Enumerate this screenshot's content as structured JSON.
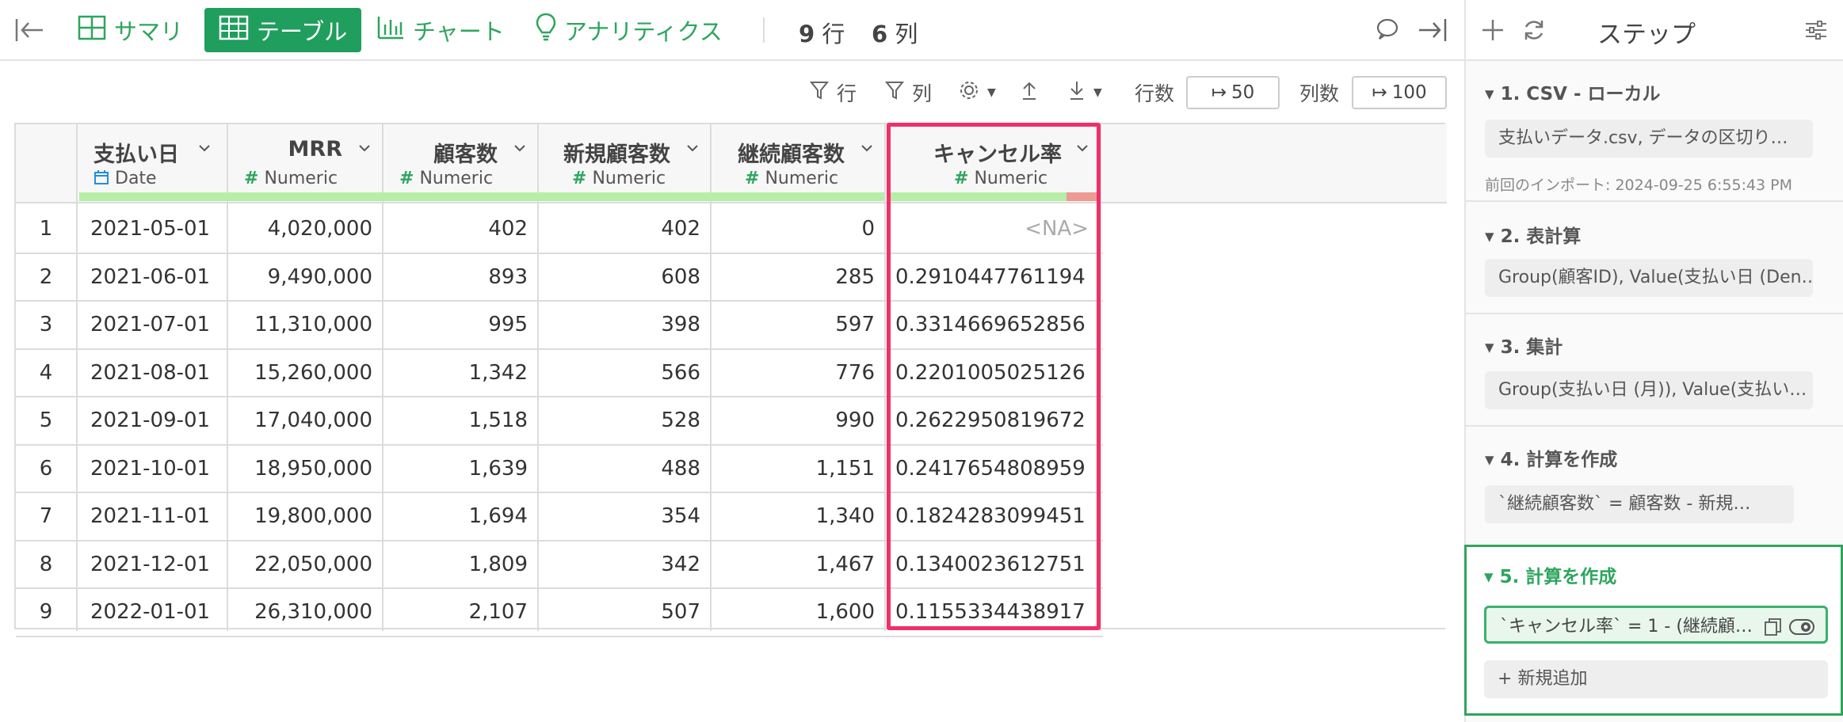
{
  "toolbar": {
    "summary_label": "サマリ",
    "table_label": "テーブル",
    "chart_label": "チャート",
    "analytics_label": "アナリティクス",
    "rows_count": "9",
    "rows_unit": "行",
    "cols_count": "6",
    "cols_unit": "列"
  },
  "subtoolbar": {
    "row_filter_label": "行",
    "col_filter_label": "列",
    "row_count_label": "行数",
    "row_count_value": "50",
    "col_count_label": "列数",
    "col_count_value": "100"
  },
  "table": {
    "columns": [
      {
        "name": "支払い日",
        "type": "Date"
      },
      {
        "name": "MRR",
        "type": "Numeric"
      },
      {
        "name": "顧客数",
        "type": "Numeric"
      },
      {
        "name": "新規顧客数",
        "type": "Numeric"
      },
      {
        "name": "継続顧客数",
        "type": "Numeric"
      },
      {
        "name": "キャンセル率",
        "type": "Numeric"
      }
    ],
    "rows": [
      {
        "n": "1",
        "date": "2021-05-01",
        "mrr": "4,020,000",
        "cust": "402",
        "new": "402",
        "cont": "0",
        "cancel": "<NA>"
      },
      {
        "n": "2",
        "date": "2021-06-01",
        "mrr": "9,490,000",
        "cust": "893",
        "new": "608",
        "cont": "285",
        "cancel": "0.2910447761194"
      },
      {
        "n": "3",
        "date": "2021-07-01",
        "mrr": "11,310,000",
        "cust": "995",
        "new": "398",
        "cont": "597",
        "cancel": "0.3314669652856"
      },
      {
        "n": "4",
        "date": "2021-08-01",
        "mrr": "15,260,000",
        "cust": "1,342",
        "new": "566",
        "cont": "776",
        "cancel": "0.2201005025126"
      },
      {
        "n": "5",
        "date": "2021-09-01",
        "mrr": "17,040,000",
        "cust": "1,518",
        "new": "528",
        "cont": "990",
        "cancel": "0.2622950819672"
      },
      {
        "n": "6",
        "date": "2021-10-01",
        "mrr": "18,950,000",
        "cust": "1,639",
        "new": "488",
        "cont": "1,151",
        "cancel": "0.2417654808959"
      },
      {
        "n": "7",
        "date": "2021-11-01",
        "mrr": "19,800,000",
        "cust": "1,694",
        "new": "354",
        "cont": "1,340",
        "cancel": "0.1824283099451"
      },
      {
        "n": "8",
        "date": "2021-12-01",
        "mrr": "22,050,000",
        "cust": "1,809",
        "new": "342",
        "cont": "1,467",
        "cancel": "0.1340023612751"
      },
      {
        "n": "9",
        "date": "2022-01-01",
        "mrr": "26,310,000",
        "cust": "2,107",
        "new": "507",
        "cont": "1,600",
        "cancel": "0.1155334438917"
      }
    ]
  },
  "panel": {
    "title": "ステップ",
    "steps": [
      {
        "title": "1. CSV - ローカル",
        "summary": "支払いデータ.csv, データの区切り…",
        "meta": "前回のインポート: 2024-09-25 6:55:43 PM"
      },
      {
        "title": "2. 表計算",
        "summary": "Group(顧客ID), Value(支払い日 (Den…"
      },
      {
        "title": "3. 集計",
        "summary": "Group(支払い日 (月)), Value(支払い…"
      },
      {
        "title": "4. 計算を作成",
        "summary": "`継続顧客数` = 顧客数 - 新規…"
      },
      {
        "title": "5. 計算を作成",
        "summary": "`キャンセル率` = 1 - (継続顧…"
      }
    ],
    "add_new_label": "新規追加"
  },
  "colors": {
    "accent": "#209e5d",
    "highlight": "#f0306a",
    "quality_ok": "#b6eea8",
    "quality_bad": "#ee9a92"
  }
}
